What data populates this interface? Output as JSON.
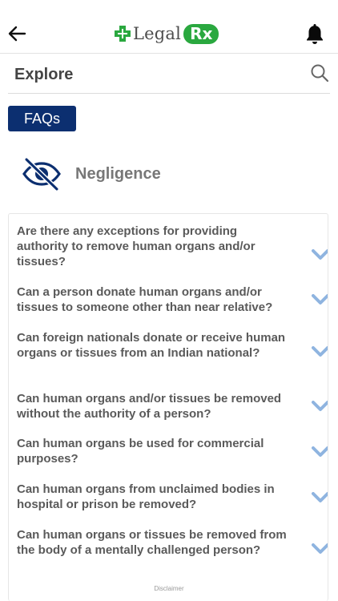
{
  "header": {
    "logo_text": "Legal",
    "logo_badge": "Rx",
    "brand_green": "#2aa83f",
    "back_icon": "arrow-left-icon",
    "bell_icon": "bell-icon"
  },
  "explore": {
    "title": "Explore",
    "search_icon": "search-icon"
  },
  "faqs_button": {
    "label": "FAQs",
    "color": "#0c2f70"
  },
  "category": {
    "icon": "eye-slash-icon",
    "title": "Negligence"
  },
  "faq_items": [
    {
      "question": "Are there any exceptions for providing authority to remove human organs and/or tissues?"
    },
    {
      "question": "Can a person donate human organs and/or tissues to someone other than near relative?"
    },
    {
      "question": "Can foreign nationals donate or receive human organs or tissues from an Indian national?"
    },
    {
      "question": "Can human organs and/or tissues be removed without the authority of a person?"
    },
    {
      "question": "Can human organs be used for commercial purposes?"
    },
    {
      "question": "Can human organs from unclaimed bodies in hospital or prison be removed?"
    },
    {
      "question": "Can human organs or tissues be removed from the body of a mentally challenged person?"
    }
  ],
  "chevron_icon": "chevron-down-icon",
  "chevron_color": "#8fb4e0",
  "footer": {
    "disclaimer": "Disclaimer"
  }
}
